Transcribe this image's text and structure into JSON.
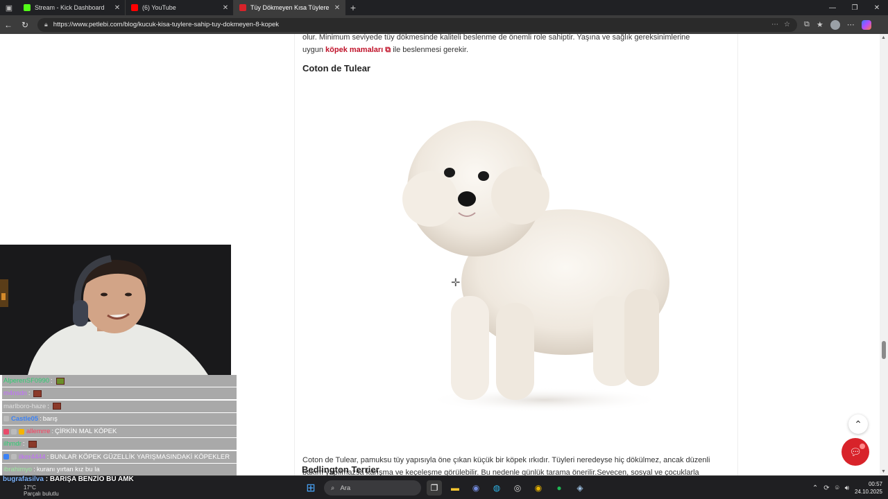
{
  "browser": {
    "tabs": [
      {
        "title": "Stream - Kick Dashboard",
        "color": "#53fc18"
      },
      {
        "title": "(6) YouTube",
        "color": "#ff0000"
      },
      {
        "title": "Tüy Dökmeyen Kısa Tüylere Sahip",
        "color": "#d8232a"
      }
    ],
    "url": "https://www.petlebi.com/blog/kucuk-kisa-tuylere-sahip-tuy-dokmeyen-8-kopek"
  },
  "article": {
    "intro_line1": "olur. Minimum seviyede tüy dökmesinde kaliteli beslenme de önemli role sahiptir. Yaşına ve sağlık gereksinimlerine",
    "intro_prefix": "uygun",
    "intro_link": "köpek mamaları",
    "intro_suffix": "ile beslenmesi gerekir.",
    "heading1": "Coton de Tulear",
    "description": "Coton de Tulear, pamuksu tüy yapısıyla öne çıkan küçük bir köpek ırkıdır. Tüyleri neredeyse hiç dökülmez, ancak düzenli bakım yapılmazsa karışma ve keçeleşme görülebilir. Bu nedenle günlük tarama önerilir.Sevecen, sosyal ve çocuklarla uyumlu yapısı sayesinde aileler için idealdir. Mutlu, enerjik ve insan odaklıdır.",
    "heading2": "Bedlington Terrier"
  },
  "chat": [
    {
      "user": "AlperenSF0990",
      "msg": "",
      "color": "#2ecc71"
    },
    {
      "user": "m4nsdn",
      "msg": "",
      "color": "#c36bff"
    },
    {
      "user": "marlboro-haze",
      "msg": "",
      "color": "#bdbdbd"
    },
    {
      "user": "Castle05",
      "msg": "barış",
      "color": "#3b82f6"
    },
    {
      "user": "allemrre",
      "msg": "ÇİRKİN MAL KÖPEK",
      "color": "#ff3b5c"
    },
    {
      "user": "ilhmdr",
      "msg": "",
      "color": "#2ecc71"
    },
    {
      "user": "ilker4444",
      "msg": "BUNLAR KÖPEK GÜZELLİK YARIŞMASINDAKİ KÖPEKLER",
      "color": "#c36bff"
    },
    {
      "user": "ibrahimyo",
      "msg": "kuranı yırtan kız bu la",
      "color": "#9be7a0"
    }
  ],
  "last_chat": {
    "user": "bugrafasilva",
    "msg": "BARIŞA BENZİO BU AMK"
  },
  "taskbar": {
    "weather_temp": "17°C",
    "weather_desc": "Parçalı bulutlu",
    "search_placeholder": "Ara",
    "time": "00:57",
    "date": "24.10.2025"
  }
}
